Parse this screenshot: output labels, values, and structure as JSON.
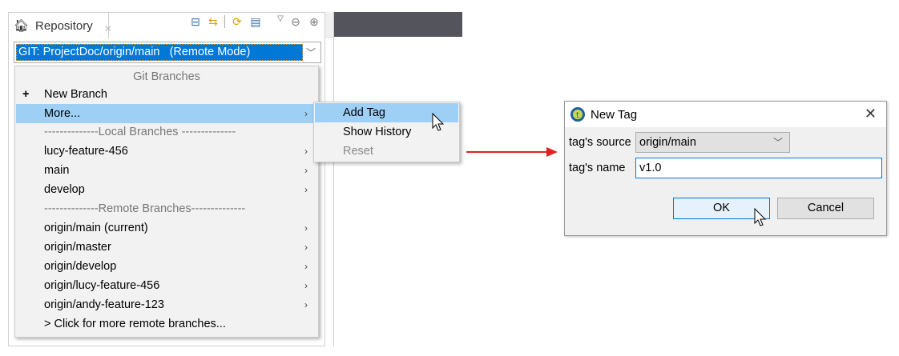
{
  "repository_view": {
    "tab_label": "Repository",
    "close_glyph": "✕",
    "toolbar_icons": [
      "collapse-all-icon",
      "link-with-editor-icon",
      "refresh-icon",
      "filter-icon",
      "view-menu-icon",
      "minimize-icon",
      "maximize-icon"
    ],
    "branch_selector": "GIT: ProjectDoc/origin/main   (Remote Mode)"
  },
  "branch_menu": {
    "header": "Git Branches",
    "items": [
      {
        "label": "New Branch",
        "icon": "+"
      },
      {
        "label": "More...",
        "submenu": true,
        "highlighted": true
      },
      {
        "label": "--------------Local   Branches --------------",
        "separator": true
      },
      {
        "label": "lucy-feature-456",
        "submenu": true
      },
      {
        "label": "main",
        "submenu": true
      },
      {
        "label": "develop",
        "submenu": true
      },
      {
        "label": "--------------Remote Branches--------------",
        "separator": true
      },
      {
        "label": "origin/main (current)",
        "submenu": true
      },
      {
        "label": "origin/master",
        "submenu": true
      },
      {
        "label": "origin/develop",
        "submenu": true
      },
      {
        "label": "origin/lucy-feature-456",
        "submenu": true
      },
      {
        "label": "origin/andy-feature-123",
        "submenu": true
      },
      {
        "label": "> Click for more remote branches..."
      }
    ]
  },
  "more_submenu": {
    "items": [
      {
        "label": "Add Tag",
        "highlighted": true
      },
      {
        "label": "Show History"
      },
      {
        "label": "Reset",
        "disabled": true
      }
    ]
  },
  "dialog": {
    "title": "New Tag",
    "source_label": "tag's source",
    "source_value": "origin/main",
    "name_label": "tag's name",
    "name_value": "v1.0",
    "ok_label": "OK",
    "cancel_label": "Cancel"
  },
  "colors": {
    "selection": "#0078d7",
    "menu_highlight": "#9ecff5",
    "arrow": "#e02020"
  }
}
